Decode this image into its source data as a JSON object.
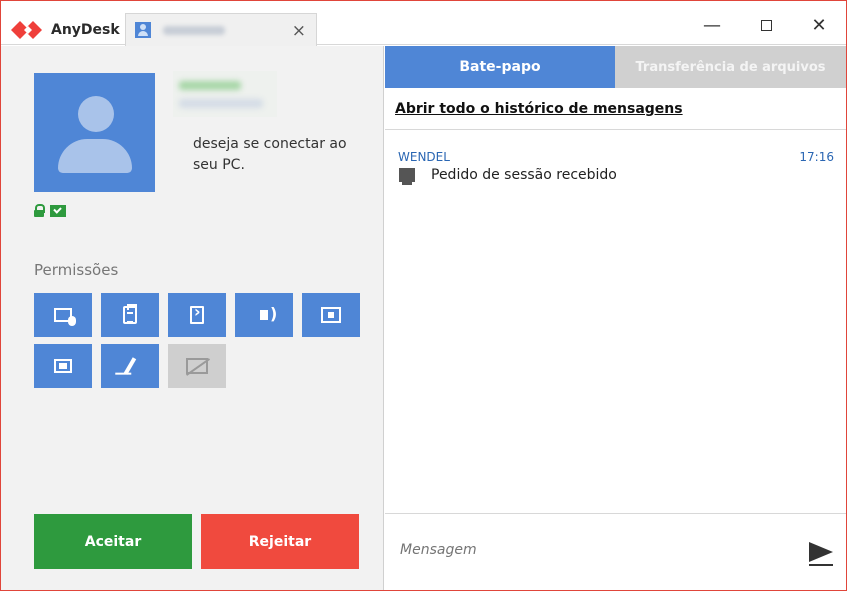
{
  "titlebar": {
    "app_title": "AnyDesk",
    "session_tab_close": "×",
    "minimize": "—",
    "close": "✕"
  },
  "request": {
    "message": "deseja se conectar ao seu PC."
  },
  "permissions": {
    "title": "Permissões",
    "buttons": [
      {
        "icon": "keyboard-mouse-icon",
        "enabled": true
      },
      {
        "icon": "clipboard-icon",
        "enabled": true
      },
      {
        "icon": "file-transfer-icon",
        "enabled": true
      },
      {
        "icon": "speaker-icon",
        "enabled": true
      },
      {
        "icon": "lock-screen-icon",
        "enabled": true
      },
      {
        "icon": "camera-icon",
        "enabled": true
      },
      {
        "icon": "pen-icon",
        "enabled": true
      },
      {
        "icon": "privacy-screen-icon",
        "enabled": false
      }
    ]
  },
  "actions": {
    "accept_label": "Aceitar",
    "reject_label": "Rejeitar"
  },
  "chat": {
    "tab_chat": "Bate-papo",
    "tab_files": "Transferência de arquivos",
    "history_link": "Abrir todo o histórico de mensagens",
    "messages": [
      {
        "sender": "WENDEL",
        "time": "17:16",
        "text": "Pedido de sessão recebido"
      }
    ],
    "input_placeholder": "Mensagem"
  },
  "colors": {
    "accent_blue": "#4f86d6",
    "accept_green": "#2e9a3e",
    "reject_red": "#f04a3e",
    "window_border": "#e0453a"
  }
}
